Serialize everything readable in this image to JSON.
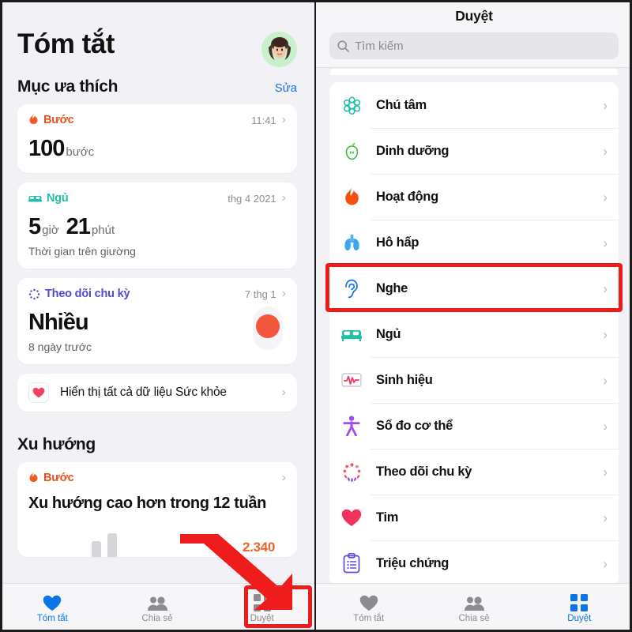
{
  "left": {
    "page_title": "Tóm tắt",
    "avatar_name": "memoji-avatar",
    "favorites": {
      "section_title": "Mục ưa thích",
      "edit_label": "Sửa",
      "cards": [
        {
          "category": "Bước",
          "category_color": "#e8501e",
          "meta": "11:41",
          "value": "100",
          "unit": "bước"
        },
        {
          "category": "Ngủ",
          "category_color": "#1fbfa8",
          "meta": "thg 4 2021",
          "value_hours": "5",
          "unit_hours": "giờ",
          "value_minutes": "21",
          "unit_minutes": "phút",
          "subtitle": "Thời gian trên giường"
        },
        {
          "category": "Theo dõi chu kỳ",
          "category_color": "#4d4ad6",
          "meta": "7 thg 1",
          "value": "Nhiều",
          "subtitle": "8 ngày trước",
          "dot_color": "#f4563c"
        }
      ]
    },
    "show_all_row": {
      "label": "Hiển thị tất cả dữ liệu Sức khỏe",
      "icon": "heart-icon"
    },
    "trends": {
      "section_title": "Xu hướng",
      "card": {
        "category": "Bước",
        "category_color": "#e8501e",
        "headline": "Xu hướng cao hơn trong 12 tuần",
        "number": "2.340",
        "number_color": "#e8642a"
      }
    },
    "tabbar": [
      {
        "label": "Tóm tắt",
        "icon": "heart-icon",
        "active": true
      },
      {
        "label": "Chia sẻ",
        "icon": "people-icon",
        "active": false
      },
      {
        "label": "Duyệt",
        "icon": "grid-icon",
        "active": false
      }
    ]
  },
  "right": {
    "page_title": "Duyệt",
    "search": {
      "placeholder": "Tìm kiếm",
      "icon": "search-icon"
    },
    "items": [
      {
        "label": "Chú tâm",
        "icon": "brain-icon",
        "color": "#1fbfa8"
      },
      {
        "label": "Dinh dưỡng",
        "icon": "apple-icon",
        "color": "#35c13e"
      },
      {
        "label": "Hoạt động",
        "icon": "flame-icon",
        "color": "#f4500f"
      },
      {
        "label": "Hô hấp",
        "icon": "lungs-icon",
        "color": "#3aa7f0"
      },
      {
        "label": "Nghe",
        "icon": "ear-icon",
        "color": "#1273e6",
        "highlighted": true
      },
      {
        "label": "Ngủ",
        "icon": "bed-icon",
        "color": "#1fbfa8"
      },
      {
        "label": "Sinh hiệu",
        "icon": "vitals-icon",
        "color": "#f2325a"
      },
      {
        "label": "Số đo cơ thể",
        "icon": "body-icon",
        "color": "#9b4df2"
      },
      {
        "label": "Theo dõi chu kỳ",
        "icon": "cycle-icon",
        "color": "#f2556d"
      },
      {
        "label": "Tim",
        "icon": "heart-icon",
        "color": "#f2325a"
      },
      {
        "label": "Triệu chứng",
        "icon": "clipboard-icon",
        "color": "#5b4ce0"
      }
    ],
    "tabbar": [
      {
        "label": "Tóm tắt",
        "icon": "heart-icon",
        "active": false
      },
      {
        "label": "Chia sẻ",
        "icon": "people-icon",
        "active": false
      },
      {
        "label": "Duyệt",
        "icon": "grid-icon",
        "active": true
      }
    ]
  },
  "annotations": {
    "highlight_color": "#ec1c1c",
    "arrow_color": "#ee1c1c",
    "boxes": [
      "nghe-row",
      "duyet-tab"
    ],
    "arrow_target": "duyet-tab"
  }
}
